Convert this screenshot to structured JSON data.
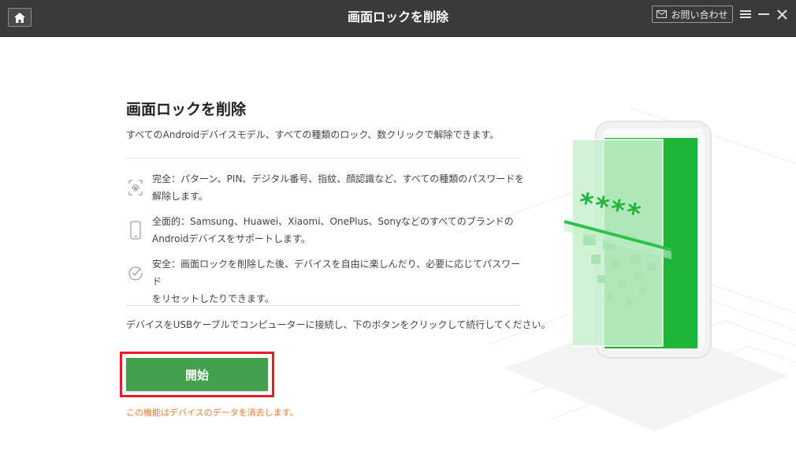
{
  "app": {
    "title": "画面ロックを削除",
    "contact_label": "お問い合わせ"
  },
  "main": {
    "heading": "画面ロックを削除",
    "subtitle": "すべてのAndroidデバイスモデル、すべての種類のロック、数クリックで解除できます。",
    "features": [
      {
        "icon": "fingerprint-icon",
        "line1": "完全：パターン、PIN、デジタル番号、指紋、顔認識など、すべての種類のパスワードを",
        "line2": "解除します。"
      },
      {
        "icon": "phone-icon",
        "line1": "全面的：Samsung、Huawei、Xiaomi、OnePlus、Sonyなどのすべてのブランドの",
        "line2": "Androidデバイスをサポートします。"
      },
      {
        "icon": "checkmark-circle-icon",
        "line1": "安全：画面ロックを削除した後、デバイスを自由に楽しんだり、必要に応じてパスワード",
        "line2": "をリセットしたりできます。"
      }
    ],
    "instruction": "デバイスをUSBケーブルでコンピューターに接続し、下のボタンをクリックして続行してください。",
    "start_label": "開始",
    "warning": "この機能はデバイスのデータを消去します。"
  },
  "illustration": {
    "password_mask": "****"
  },
  "colors": {
    "titlebar": "#3a3a3a",
    "accent_green": "#43a04c",
    "screen_green": "#1fb53a",
    "highlight_red": "#e41e25",
    "warning_orange": "#f07a2b"
  }
}
